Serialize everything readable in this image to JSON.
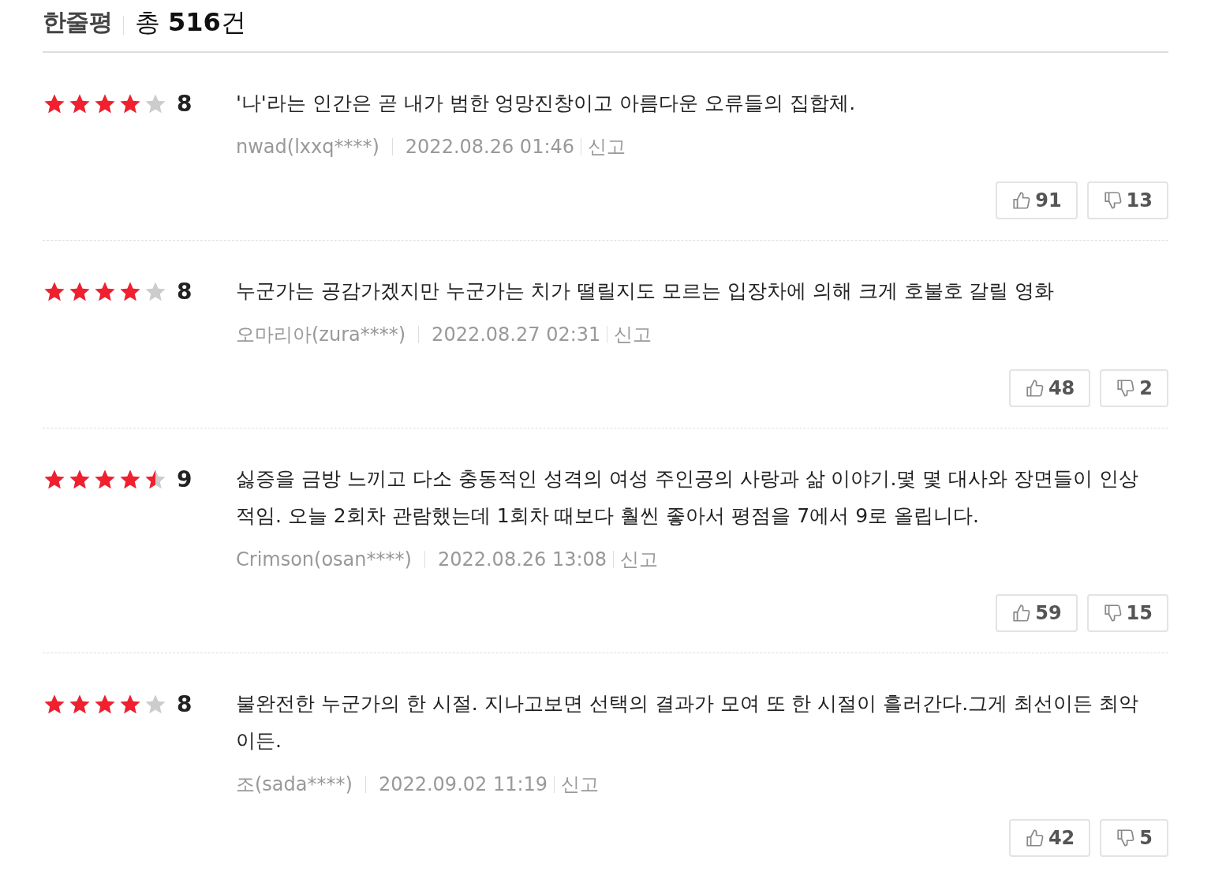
{
  "header": {
    "title": "한줄평",
    "total": "총 **516**건"
  },
  "reviews": [
    {
      "stars": 4,
      "score": "8",
      "text": "'나'라는 인간은 곧 내가 범한 엉망진창이고 아름다운 오류들의 집합체.",
      "author": "nwad(lxxq****)",
      "date": "2022.08.26 01:46",
      "report": "신고",
      "likes": "91",
      "dislikes": "13"
    },
    {
      "stars": 4,
      "score": "8",
      "text": "누군가는 공감가겠지만 누군가는 치가 떨릴지도 모르는 입장차에 의해 크게 호불호 갈릴 영화",
      "author": "오마리아(zura****)",
      "date": "2022.08.27 02:31",
      "report": "신고",
      "likes": "48",
      "dislikes": "2"
    },
    {
      "stars": 4.5,
      "score": "9",
      "text": "싫증을 금방 느끼고 다소 충동적인 성격의 여성 주인공의 사랑과 삶 이야기.몇 몇 대사와 장면들이 인상적임. 오늘 2회차 관람했는데 1회차 때보다 훨씬 좋아서 평점을 7에서 9로 올립니다.",
      "author": "Crimson(osan****)",
      "date": "2022.08.26 13:08",
      "report": "신고",
      "likes": "59",
      "dislikes": "15"
    },
    {
      "stars": 4,
      "score": "8",
      "text": "불완전한 누군가의 한 시절. 지나고보면 선택의 결과가 모여 또 한 시절이 흘러간다.그게 최선이든 최악이든.",
      "author": "조(sada****)",
      "date": "2022.09.02 11:19",
      "report": "신고",
      "likes": "42",
      "dislikes": "5"
    }
  ]
}
